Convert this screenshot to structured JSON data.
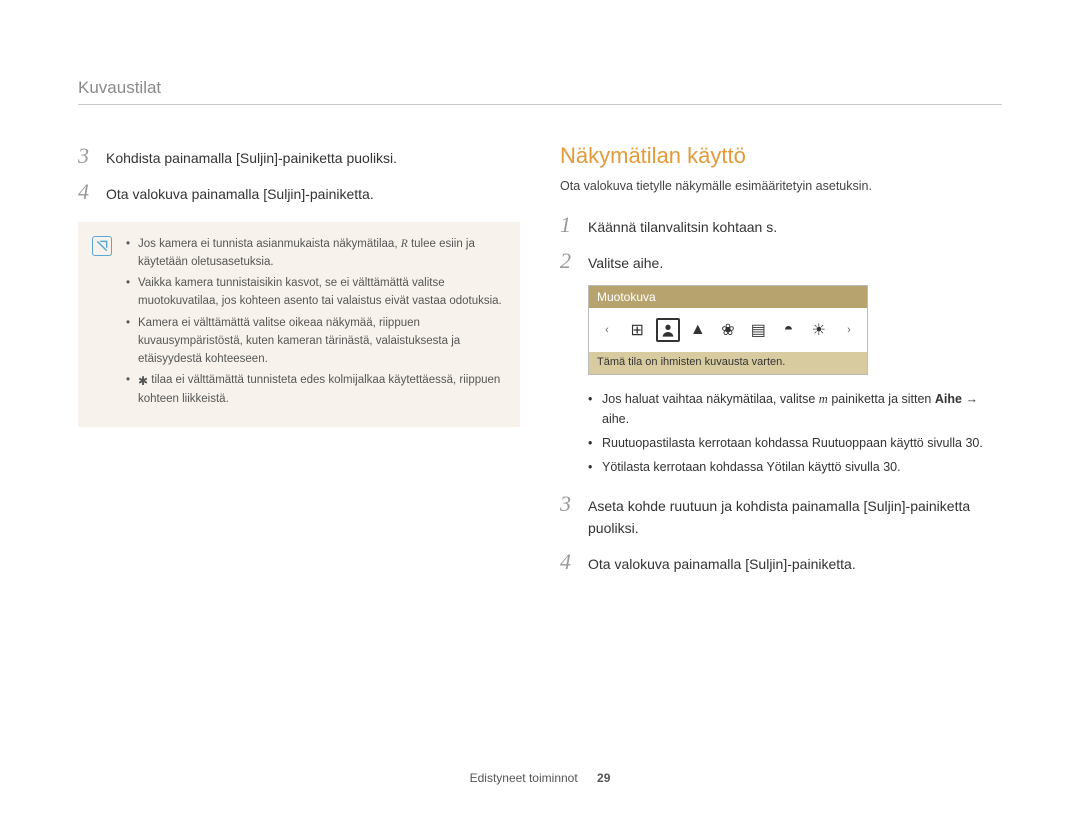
{
  "chapter": "Kuvaustilat",
  "left": {
    "step3_num": "3",
    "step3_text": "Kohdista painamalla [Suljin]-painiketta puoliksi.",
    "step4_num": "4",
    "step4_text": "Ota valokuva painamalla [Suljin]-painiketta.",
    "note": {
      "li1_a": "Jos kamera ei tunnista asianmukaista näkymätilaa, ",
      "li1_b": " tulee esiin ja käytetään oletusasetuksia.",
      "li1_icon": "R",
      "li2": "Vaikka kamera tunnistaisikin kasvot, se ei välttämättä valitse muotokuvatilaa, jos kohteen asento tai valaistus eivät vastaa odotuksia.",
      "li3": "Kamera ei välttämättä valitse oikeaa näkymää, riippuen kuvausympäristöstä, kuten kameran tärinästä, valaistuksesta ja etäisyydestä kohteeseen.",
      "li4_a": " tilaa ei välttämättä tunnisteta edes kolmijalkaa käytettäessä, riippuen kohteen liikkeistä."
    }
  },
  "right": {
    "heading": "Näkymätilan käyttö",
    "intro": "Ota valokuva tietylle näkymälle esimääritetyin asetuksin.",
    "step1_num": "1",
    "step1_text": "Käännä tilanvalitsin kohtaan s.",
    "step2_num": "2",
    "step2_text": "Valitse aihe.",
    "mode_label": "Muotokuva",
    "mode_caption": "Tämä tila on ihmisten kuvausta varten.",
    "bullets": {
      "b1_a": "Jos haluat vaihtaa näkymätilaa, valitse ",
      "b1_b": "m",
      "b1_c": " painiketta ja sitten ",
      "b1_d": "Aihe",
      "b1_e": " → aihe.",
      "b2_a": "Ruutuopastilasta kerrotaan kohdassa ",
      "b2_b": "Ruutuoppaan käyttö",
      "b2_c": " sivulla 30.",
      "b3_a": "Yötilasta kerrotaan kohdassa ",
      "b3_b": "Yötilan käyttö",
      "b3_c": " sivulla 30."
    },
    "step3_num": "3",
    "step3_text": "Aseta kohde ruutuun ja kohdista painamalla [Suljin]-painiketta puoliksi.",
    "step4_num": "4",
    "step4_text": "Ota valokuva painamalla [Suljin]-painiketta."
  },
  "footer": {
    "section": "Edistyneet toiminnot",
    "page": "29"
  }
}
